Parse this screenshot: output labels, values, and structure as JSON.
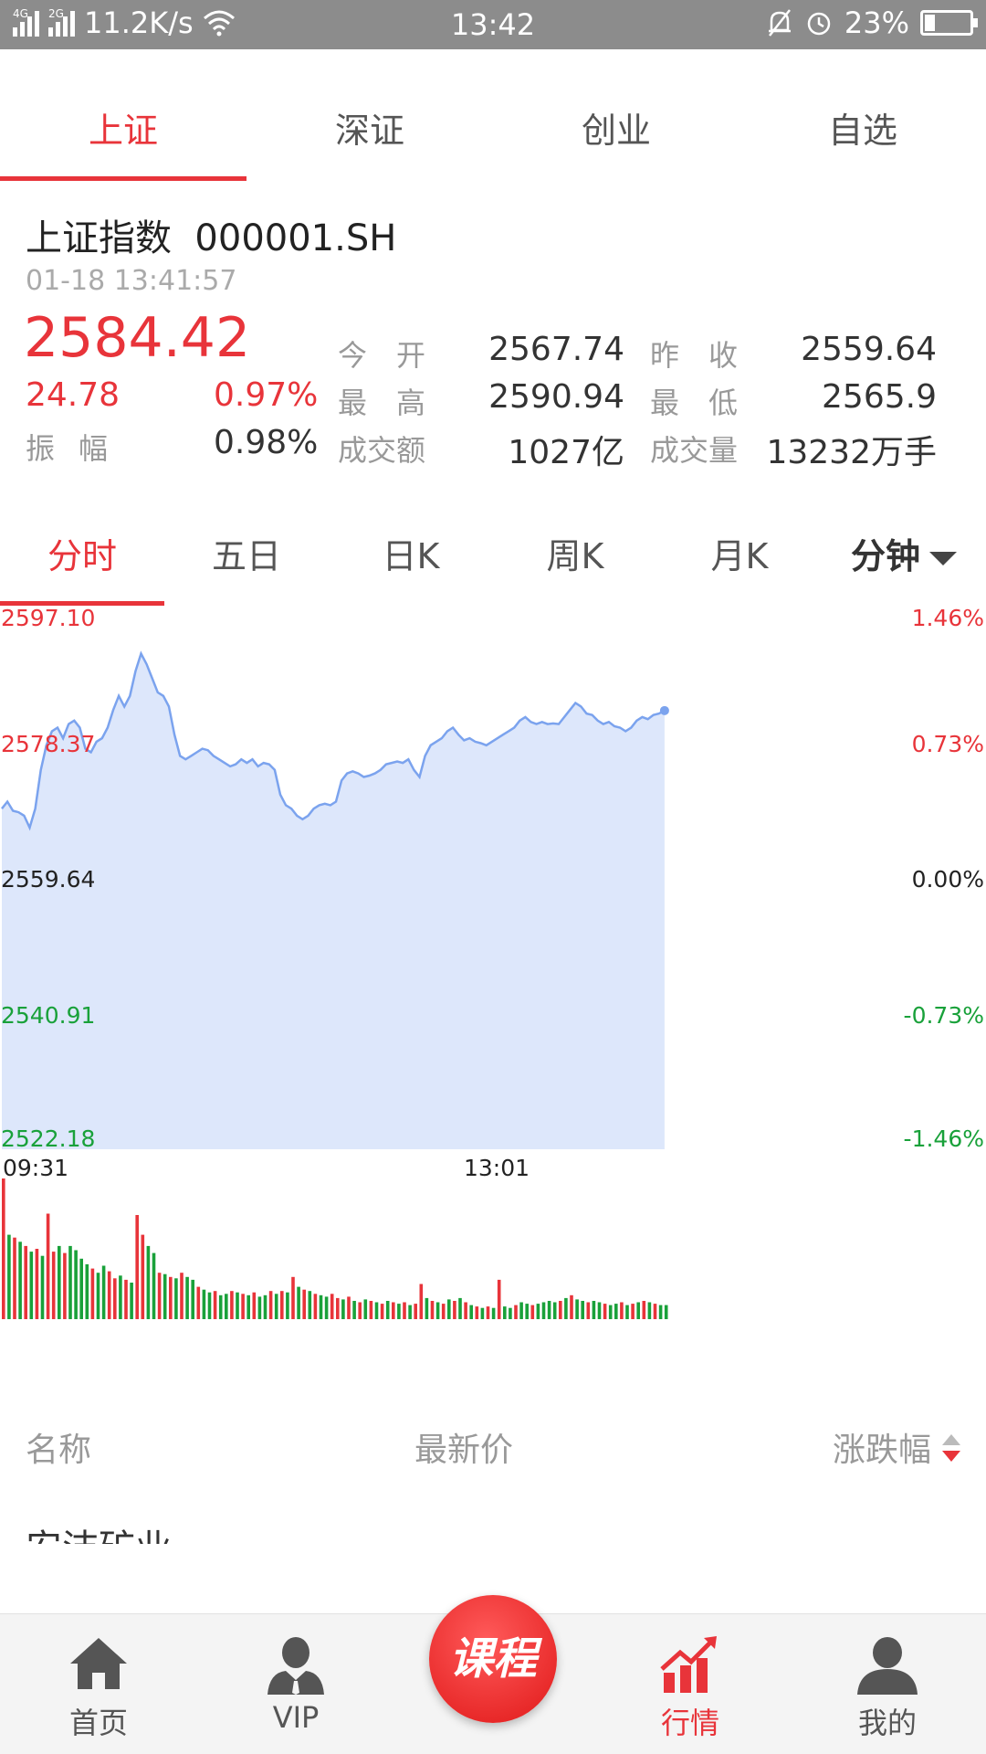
{
  "status_bar": {
    "net_left": "4G",
    "net_right": "2G",
    "speed": "11.2K/s",
    "time": "13:42",
    "battery": "23%",
    "battery_level": 0.23
  },
  "top_tabs": [
    "上证",
    "深证",
    "创业",
    "自选"
  ],
  "index": {
    "name": "上证指数  000001.SH",
    "time": "01-18 13:41:57",
    "price": "2584.42",
    "change": "24.78",
    "change_pct": "0.97%",
    "amplitude_label": "振幅",
    "amplitude": "0.98%",
    "stats": [
      {
        "label": "今　开",
        "value": "2567.74"
      },
      {
        "label": "昨　收",
        "value": "2559.64"
      },
      {
        "label": "最　高",
        "value": "2590.94"
      },
      {
        "label": "最　低",
        "value": "2565.9"
      },
      {
        "label": "成交额",
        "value": "1027亿"
      },
      {
        "label": "成交量",
        "value": "13232万手"
      }
    ]
  },
  "period_tabs": [
    "分时",
    "五日",
    "日K",
    "周K",
    "月K",
    "分钟"
  ],
  "chart_data": {
    "type": "area",
    "y_labels_left": [
      "2597.10",
      "2578.37",
      "2559.64",
      "2540.91",
      "2522.18"
    ],
    "y_labels_right": [
      "1.46%",
      "0.73%",
      "0.00%",
      "-0.73%",
      "-1.46%"
    ],
    "x_labels": [
      "09:31",
      "13:01"
    ],
    "ylim": [
      2522.18,
      2597.1
    ],
    "base": 2559.64,
    "total_points": 240,
    "price_points": [
      [
        0,
        2570.5
      ],
      [
        2,
        2571.5
      ],
      [
        4,
        2570.2
      ],
      [
        6,
        2570.0
      ],
      [
        8,
        2569.5
      ],
      [
        10,
        2567.8
      ],
      [
        12,
        2570.5
      ],
      [
        14,
        2576.0
      ],
      [
        16,
        2579.5
      ],
      [
        18,
        2581.5
      ],
      [
        20,
        2582.0
      ],
      [
        22,
        2580.5
      ],
      [
        24,
        2582.5
      ],
      [
        26,
        2583.0
      ],
      [
        28,
        2582.0
      ],
      [
        30,
        2579.0
      ],
      [
        32,
        2578.5
      ],
      [
        34,
        2580.0
      ],
      [
        36,
        2580.5
      ],
      [
        38,
        2582.0
      ],
      [
        40,
        2584.5
      ],
      [
        42,
        2586.5
      ],
      [
        44,
        2585.0
      ],
      [
        46,
        2586.5
      ],
      [
        48,
        2590.0
      ],
      [
        50,
        2592.5
      ],
      [
        52,
        2591.0
      ],
      [
        54,
        2589.0
      ],
      [
        56,
        2587.0
      ],
      [
        58,
        2586.5
      ],
      [
        60,
        2585.0
      ],
      [
        62,
        2581.0
      ],
      [
        64,
        2578.0
      ],
      [
        66,
        2577.5
      ],
      [
        68,
        2578.0
      ],
      [
        70,
        2578.5
      ],
      [
        72,
        2579.0
      ],
      [
        74,
        2578.8
      ],
      [
        76,
        2578.0
      ],
      [
        78,
        2577.5
      ],
      [
        80,
        2577.0
      ],
      [
        82,
        2576.5
      ],
      [
        84,
        2576.8
      ],
      [
        86,
        2577.5
      ],
      [
        88,
        2577.0
      ],
      [
        90,
        2577.5
      ],
      [
        92,
        2576.5
      ],
      [
        94,
        2577.0
      ],
      [
        96,
        2576.8
      ],
      [
        98,
        2576.0
      ],
      [
        100,
        2572.5
      ],
      [
        102,
        2571.0
      ],
      [
        104,
        2570.5
      ],
      [
        106,
        2569.5
      ],
      [
        108,
        2569.0
      ],
      [
        110,
        2569.5
      ],
      [
        112,
        2570.5
      ],
      [
        114,
        2571.0
      ],
      [
        116,
        2571.2
      ],
      [
        118,
        2571.0
      ],
      [
        120,
        2571.5
      ],
      [
        122,
        2574.5
      ],
      [
        124,
        2575.5
      ],
      [
        126,
        2575.8
      ],
      [
        128,
        2575.5
      ],
      [
        130,
        2575.0
      ],
      [
        132,
        2575.2
      ],
      [
        134,
        2575.5
      ],
      [
        136,
        2576.0
      ],
      [
        138,
        2576.8
      ],
      [
        140,
        2577.0
      ],
      [
        142,
        2577.2
      ],
      [
        144,
        2577.0
      ],
      [
        146,
        2577.5
      ],
      [
        148,
        2576.0
      ],
      [
        150,
        2575.0
      ],
      [
        152,
        2578.0
      ],
      [
        154,
        2579.5
      ],
      [
        156,
        2580.0
      ],
      [
        158,
        2580.5
      ],
      [
        160,
        2581.5
      ],
      [
        162,
        2582.0
      ],
      [
        164,
        2581.0
      ],
      [
        166,
        2580.2
      ],
      [
        168,
        2580.5
      ],
      [
        170,
        2580.0
      ],
      [
        172,
        2579.8
      ],
      [
        174,
        2579.5
      ],
      [
        176,
        2580.0
      ],
      [
        178,
        2580.5
      ],
      [
        180,
        2581.0
      ],
      [
        182,
        2581.5
      ],
      [
        184,
        2582.0
      ],
      [
        186,
        2583.0
      ],
      [
        188,
        2583.5
      ],
      [
        190,
        2582.8
      ],
      [
        192,
        2582.5
      ],
      [
        194,
        2582.8
      ],
      [
        196,
        2582.5
      ],
      [
        198,
        2582.6
      ],
      [
        200,
        2582.5
      ],
      [
        202,
        2583.5
      ],
      [
        204,
        2584.5
      ],
      [
        206,
        2585.5
      ],
      [
        208,
        2585.0
      ],
      [
        210,
        2584.0
      ],
      [
        212,
        2583.8
      ],
      [
        214,
        2583.0
      ],
      [
        216,
        2582.5
      ],
      [
        218,
        2582.8
      ],
      [
        220,
        2582.2
      ],
      [
        222,
        2582.0
      ],
      [
        224,
        2581.5
      ],
      [
        226,
        2582.0
      ],
      [
        228,
        2583.0
      ],
      [
        230,
        2583.5
      ],
      [
        232,
        2583.2
      ],
      [
        234,
        2583.8
      ],
      [
        236,
        2584.0
      ],
      [
        238,
        2584.42
      ]
    ],
    "volume_max": 100,
    "volumes": [
      [
        0,
        100,
        "up"
      ],
      [
        2,
        60,
        "down"
      ],
      [
        4,
        58,
        "up"
      ],
      [
        6,
        55,
        "down"
      ],
      [
        8,
        52,
        "up"
      ],
      [
        10,
        48,
        "down"
      ],
      [
        12,
        50,
        "up"
      ],
      [
        14,
        45,
        "down"
      ],
      [
        16,
        75,
        "up"
      ],
      [
        18,
        48,
        "up"
      ],
      [
        20,
        52,
        "down"
      ],
      [
        22,
        47,
        "up"
      ],
      [
        24,
        52,
        "down"
      ],
      [
        26,
        49,
        "down"
      ],
      [
        28,
        43,
        "down"
      ],
      [
        30,
        39,
        "down"
      ],
      [
        32,
        36,
        "up"
      ],
      [
        34,
        33,
        "down"
      ],
      [
        36,
        38,
        "down"
      ],
      [
        38,
        34,
        "up"
      ],
      [
        40,
        29,
        "up"
      ],
      [
        42,
        31,
        "down"
      ],
      [
        44,
        28,
        "up"
      ],
      [
        46,
        26,
        "down"
      ],
      [
        48,
        74,
        "up"
      ],
      [
        50,
        60,
        "up"
      ],
      [
        52,
        52,
        "down"
      ],
      [
        54,
        47,
        "down"
      ],
      [
        56,
        33,
        "up"
      ],
      [
        58,
        32,
        "down"
      ],
      [
        60,
        30,
        "up"
      ],
      [
        62,
        29,
        "down"
      ],
      [
        64,
        33,
        "up"
      ],
      [
        66,
        30,
        "down"
      ],
      [
        68,
        28,
        "down"
      ],
      [
        70,
        23,
        "up"
      ],
      [
        72,
        21,
        "down"
      ],
      [
        74,
        19,
        "down"
      ],
      [
        76,
        20,
        "up"
      ],
      [
        78,
        17,
        "down"
      ],
      [
        80,
        18,
        "down"
      ],
      [
        82,
        20,
        "up"
      ],
      [
        84,
        19,
        "down"
      ],
      [
        86,
        18,
        "up"
      ],
      [
        88,
        17,
        "down"
      ],
      [
        90,
        19,
        "up"
      ],
      [
        92,
        16,
        "down"
      ],
      [
        94,
        17,
        "down"
      ],
      [
        96,
        20,
        "up"
      ],
      [
        98,
        18,
        "down"
      ],
      [
        100,
        20,
        "up"
      ],
      [
        102,
        19,
        "down"
      ],
      [
        104,
        30,
        "up"
      ],
      [
        106,
        23,
        "down"
      ],
      [
        108,
        21,
        "up"
      ],
      [
        110,
        20,
        "down"
      ],
      [
        112,
        18,
        "up"
      ],
      [
        114,
        17,
        "down"
      ],
      [
        116,
        16,
        "down"
      ],
      [
        118,
        18,
        "up"
      ],
      [
        120,
        15,
        "up"
      ],
      [
        122,
        14,
        "down"
      ],
      [
        124,
        16,
        "up"
      ],
      [
        126,
        13,
        "down"
      ],
      [
        128,
        12,
        "up"
      ],
      [
        130,
        14,
        "down"
      ],
      [
        132,
        13,
        "up"
      ],
      [
        134,
        12,
        "down"
      ],
      [
        136,
        11,
        "up"
      ],
      [
        138,
        13,
        "down"
      ],
      [
        140,
        12,
        "up"
      ],
      [
        142,
        11,
        "down"
      ],
      [
        144,
        12,
        "up"
      ],
      [
        146,
        10,
        "down"
      ],
      [
        148,
        11,
        "up"
      ],
      [
        150,
        25,
        "up"
      ],
      [
        152,
        15,
        "down"
      ],
      [
        154,
        13,
        "up"
      ],
      [
        156,
        12,
        "down"
      ],
      [
        158,
        11,
        "up"
      ],
      [
        160,
        14,
        "down"
      ],
      [
        162,
        13,
        "up"
      ],
      [
        164,
        15,
        "down"
      ],
      [
        166,
        12,
        "up"
      ],
      [
        168,
        10,
        "down"
      ],
      [
        170,
        9,
        "up"
      ],
      [
        172,
        8,
        "down"
      ],
      [
        174,
        9,
        "up"
      ],
      [
        176,
        8,
        "down"
      ],
      [
        178,
        28,
        "up"
      ],
      [
        180,
        9,
        "down"
      ],
      [
        182,
        8,
        "down"
      ],
      [
        184,
        10,
        "up"
      ],
      [
        186,
        12,
        "down"
      ],
      [
        188,
        11,
        "down"
      ],
      [
        190,
        10,
        "up"
      ],
      [
        192,
        11,
        "down"
      ],
      [
        194,
        12,
        "down"
      ],
      [
        196,
        13,
        "down"
      ],
      [
        198,
        12,
        "down"
      ],
      [
        200,
        13,
        "up"
      ],
      [
        202,
        15,
        "down"
      ],
      [
        204,
        17,
        "up"
      ],
      [
        206,
        14,
        "down"
      ],
      [
        208,
        13,
        "down"
      ],
      [
        210,
        12,
        "up"
      ],
      [
        212,
        13,
        "down"
      ],
      [
        214,
        12,
        "down"
      ],
      [
        216,
        11,
        "up"
      ],
      [
        218,
        10,
        "down"
      ],
      [
        220,
        11,
        "down"
      ],
      [
        222,
        12,
        "up"
      ],
      [
        224,
        10,
        "down"
      ],
      [
        226,
        11,
        "up"
      ],
      [
        228,
        12,
        "down"
      ],
      [
        230,
        13,
        "up"
      ],
      [
        232,
        12,
        "down"
      ],
      [
        234,
        11,
        "up"
      ],
      [
        236,
        10,
        "down"
      ],
      [
        238,
        10,
        "down"
      ]
    ]
  },
  "list_header": {
    "name": "名称",
    "price": "最新价",
    "change": "涨跌幅"
  },
  "list_first_row": "安洁矿业",
  "bottom_nav": {
    "items": [
      {
        "label": "首页",
        "icon": "home-icon"
      },
      {
        "label": "VIP",
        "icon": "vip-user-icon"
      },
      {
        "label": "行情",
        "icon": "market-chart-icon"
      },
      {
        "label": "我的",
        "icon": "profile-icon"
      }
    ],
    "course": "课程"
  },
  "colors": {
    "up": "#e8343a",
    "down": "#19a13a",
    "accent": "#e8343a",
    "chart_fill": "#dde7fb",
    "chart_line": "#7ba3ee"
  }
}
